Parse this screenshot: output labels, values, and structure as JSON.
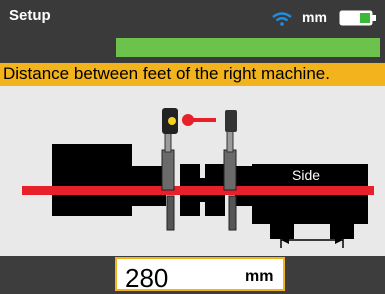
{
  "header": {
    "title": "Setup",
    "unit": "mm",
    "wifi_icon": "wifi-icon",
    "battery_icon": "battery-icon",
    "progress_fraction": 1.0
  },
  "instruction": "Distance between feet of the right machine.",
  "diagram": {
    "side_label": "Side"
  },
  "entry": {
    "value": "280",
    "unit": "mm"
  },
  "colors": {
    "accent": "#f2b31c",
    "progress": "#6cc24a",
    "shaft": "#e8202a",
    "wifi": "#1e8fe0"
  }
}
